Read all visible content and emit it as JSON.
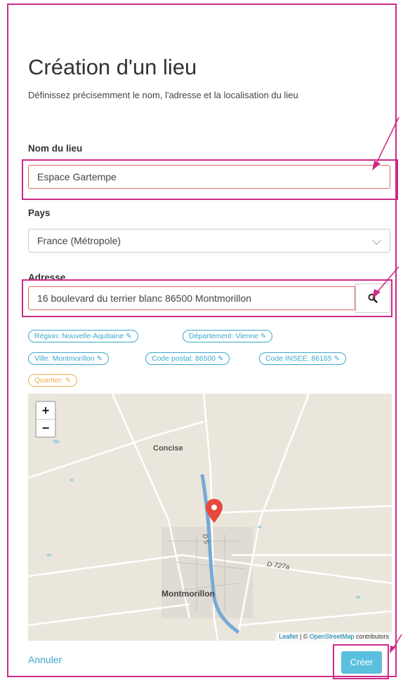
{
  "title": "Création d'un lieu",
  "subtitle": "Définissez précisemment le nom, l'adresse et la localisation du lieu",
  "fields": {
    "name": {
      "label": "Nom du lieu",
      "value": "Espace Gartempe"
    },
    "country": {
      "label": "Pays",
      "value": "France (Métropole)"
    },
    "address": {
      "label": "Adresse",
      "value": "16 boulevard du terrier blanc 86500 Montmorillon"
    }
  },
  "tags": [
    {
      "text": "Région: Nouvelle-Aquitaine"
    },
    {
      "text": "Département: Vienne"
    },
    {
      "text": "Ville: Montmorillon"
    },
    {
      "text": "Code postal: 86500"
    },
    {
      "text": "Code INSEE: 86165"
    },
    {
      "text": "Quartier:"
    }
  ],
  "map": {
    "zoom_in": "+",
    "zoom_out": "−",
    "labels": {
      "concise": "Concise",
      "montmorillon": "Montmorillon",
      "d5": "D 5",
      "d727a": "D 727a"
    },
    "attribution": {
      "leaflet": "Leaflet",
      "sep": " | © ",
      "osm": "OpenStreetMap",
      "contrib": " contributors"
    }
  },
  "actions": {
    "cancel": "Annuler",
    "create": "Créer"
  },
  "colors": {
    "highlight": "#cc2a86",
    "info": "#39a9c9",
    "warning": "#f0ad4e",
    "primary": "#5bc0de"
  }
}
